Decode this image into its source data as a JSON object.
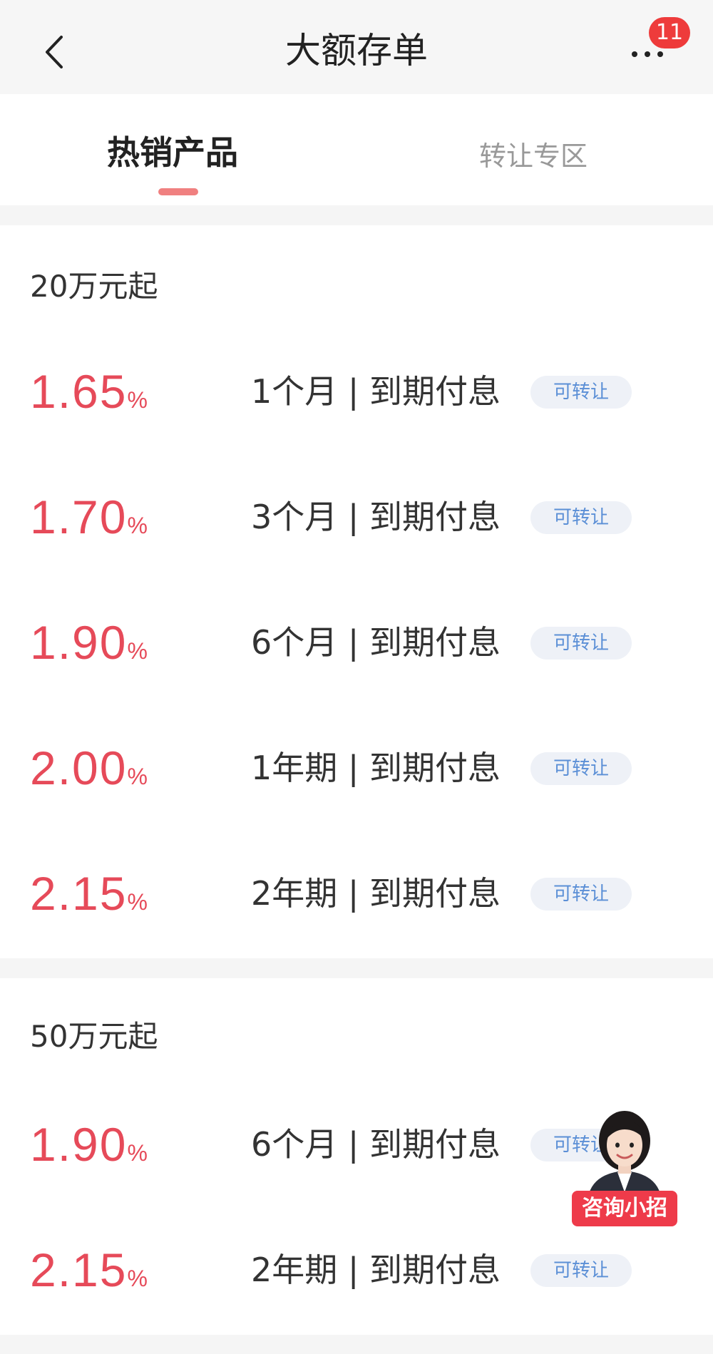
{
  "header": {
    "title": "大额存单",
    "badge_count": "11",
    "icons": {
      "back": "chevron-left-icon",
      "more": "more-dots-icon"
    }
  },
  "tabs": [
    {
      "label": "热销产品",
      "active": true
    },
    {
      "label": "转让专区",
      "active": false
    }
  ],
  "sections": [
    {
      "title": "20万元起",
      "products": [
        {
          "rate": "1.65",
          "unit": "%",
          "term": "1个月 | 到期付息",
          "tag": "可转让"
        },
        {
          "rate": "1.70",
          "unit": "%",
          "term": "3个月 | 到期付息",
          "tag": "可转让"
        },
        {
          "rate": "1.90",
          "unit": "%",
          "term": "6个月 | 到期付息",
          "tag": "可转让"
        },
        {
          "rate": "2.00",
          "unit": "%",
          "term": "1年期 | 到期付息",
          "tag": "可转让"
        },
        {
          "rate": "2.15",
          "unit": "%",
          "term": "2年期 | 到期付息",
          "tag": "可转让"
        }
      ]
    },
    {
      "title": "50万元起",
      "products": [
        {
          "rate": "1.90",
          "unit": "%",
          "term": "6个月 | 到期付息",
          "tag": "可转让"
        },
        {
          "rate": "2.15",
          "unit": "%",
          "term": "2年期 | 到期付息",
          "tag": "可转让"
        }
      ]
    }
  ],
  "assistant": {
    "label": "咨询小招",
    "icon": "assistant-avatar-icon"
  },
  "colors": {
    "rate": "#e64a59",
    "tag_text": "#5b8fd6",
    "tag_bg": "#eef1f7",
    "badge": "#ee3b3b"
  }
}
